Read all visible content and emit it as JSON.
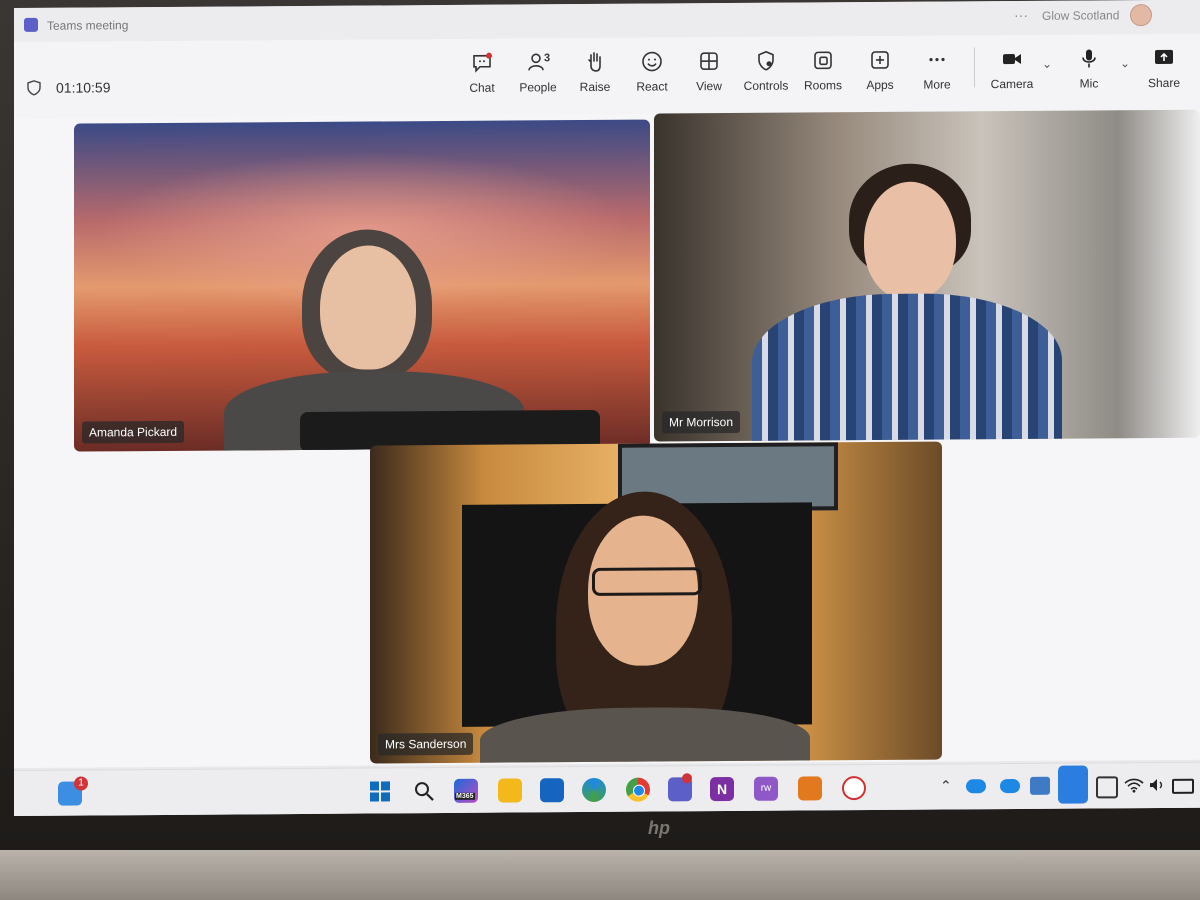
{
  "window": {
    "title": "Teams meeting",
    "org": "Glow Scotland",
    "more_dots": "···"
  },
  "meeting": {
    "timer": "01:10:59"
  },
  "toolbar": {
    "chat": "Chat",
    "people": "People",
    "people_count": "3",
    "raise": "Raise",
    "react": "React",
    "view": "View",
    "controls": "Controls",
    "rooms": "Rooms",
    "apps": "Apps",
    "more": "More",
    "camera": "Camera",
    "mic": "Mic",
    "share": "Share"
  },
  "participants": [
    {
      "name": "Amanda Pickard"
    },
    {
      "name": "Mr Morrison"
    },
    {
      "name": "Mrs Sanderson"
    }
  ],
  "taskbar": {
    "notification_count": "1",
    "m365_label": "M365",
    "onenote_letter": "N",
    "rw_label": "rw"
  },
  "laptop": {
    "brand": "hp"
  },
  "colors": {
    "teams_accent": "#5b5fc7",
    "badge_red": "#d13438",
    "name_plate": "#3a3a3a"
  }
}
